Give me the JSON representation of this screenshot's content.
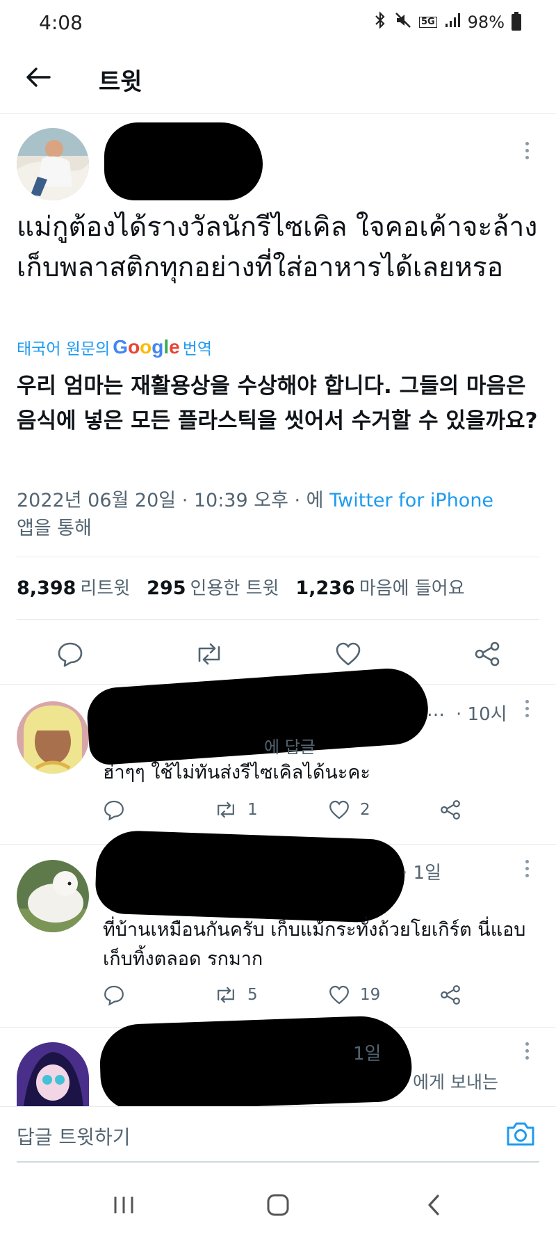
{
  "status_bar": {
    "time": "4:08",
    "network": "5G",
    "battery": "98%"
  },
  "header": {
    "title": "트윗"
  },
  "tweet": {
    "text_thai": "แม่กูต้องได้รางวัลนักรีไซเคิล ใจคอเค้าจะล้างเก็บพลาสติกทุกอย่างที่ใส่อาหารได้เลยหรอ",
    "translate_prefix": "태국어 원문의",
    "translate_brand": "Google",
    "translate_suffix": "번역",
    "translated_text": "우리 엄마는 재활용상을 수상해야 합니다. 그들의 마음은 음식에 넣은 모든 플라스틱을 씻어서 수거할 수 있을까요?",
    "meta_datetime": "2022년 06월 20일 · 10:39 오후 · 에",
    "meta_source": "Twitter for iPhone",
    "meta_suffix": "앱을 통해",
    "stats": [
      {
        "value": "8,398",
        "label": "리트윗"
      },
      {
        "value": "295",
        "label": "인용한 트윗"
      },
      {
        "value": "1,236",
        "label": "마음에 들어요"
      }
    ]
  },
  "replies": [
    {
      "time": "· 10시",
      "ellipsis": "…",
      "reply_to_fragment": "에 답글",
      "text": "ฮ่าๆๆ ใช้ไม่ทันส่งรีไซเคิลได้นะคะ",
      "retweets": "1",
      "likes": "2"
    },
    {
      "time": "· 1일",
      "text": "ที่บ้านเหมือนกันครับ เก็บแม้กระทั่งถ้วยโยเกิร์ต นี่แอบเก็บทิ้งตลอด รกมาก",
      "retweets": "5",
      "likes": "19"
    },
    {
      "time": "1일",
      "reply_to_fragment": "에게 보내는"
    }
  ],
  "compose": {
    "placeholder": "답글 트윗하기"
  }
}
